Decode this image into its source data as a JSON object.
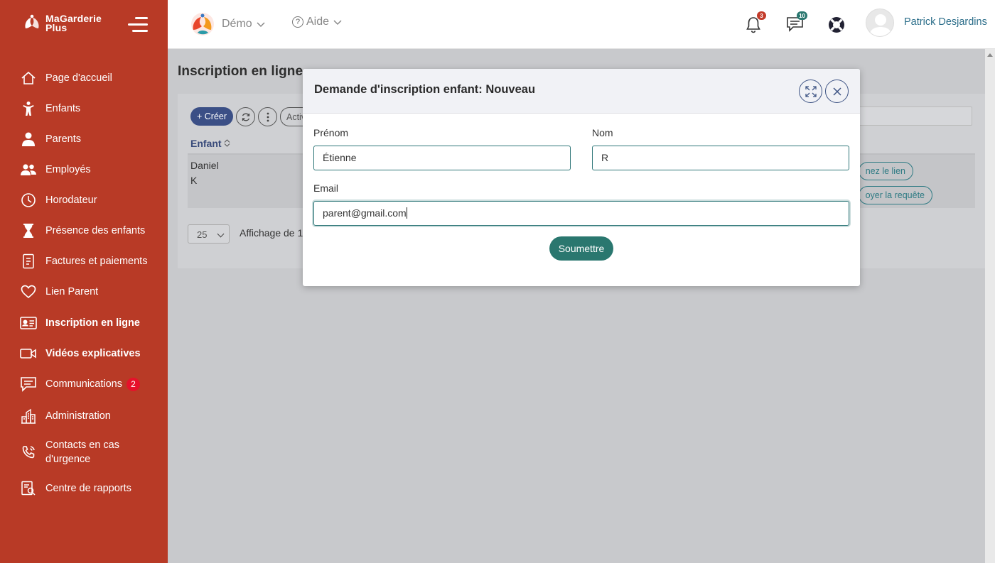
{
  "brand": {
    "line1": "MaGarderie",
    "line2": "Plus"
  },
  "sidebar": {
    "items": [
      {
        "label": "Page d'accueil",
        "icon": "home-icon"
      },
      {
        "label": "Enfants",
        "icon": "child-icon"
      },
      {
        "label": "Parents",
        "icon": "parent-icon"
      },
      {
        "label": "Employés",
        "icon": "employees-icon"
      },
      {
        "label": "Horodateur",
        "icon": "clock-icon"
      },
      {
        "label": "Présence des enfants",
        "icon": "hourglass-icon"
      },
      {
        "label": "Factures et paiements",
        "icon": "invoice-icon"
      },
      {
        "label": "Lien Parent",
        "icon": "heart-icon"
      },
      {
        "label": "Inscription en ligne",
        "icon": "id-card-icon",
        "active": true
      },
      {
        "label": "Vidéos explicatives",
        "icon": "video-icon"
      },
      {
        "label": "Communications",
        "icon": "chat-icon",
        "badge": "2"
      },
      {
        "label": "Administration",
        "icon": "building-icon"
      },
      {
        "label": "Contacts en cas",
        "label2": "d'urgence",
        "icon": "phone-icon"
      },
      {
        "label": "Centre de rapports",
        "icon": "report-icon"
      }
    ]
  },
  "header": {
    "demo_label": "Démo",
    "help_label": "Aide",
    "notifications_count": "3",
    "messages_count": "10",
    "user_name": "Patrick Desjardins"
  },
  "main": {
    "title": "Inscription en ligne",
    "toolbar": {
      "create_label": "+ Créer",
      "activ_label": "Activ"
    },
    "table": {
      "column_enfant": "Enfant",
      "row": {
        "first_name": "Daniel",
        "last_name": "K",
        "action1": "nez le lien",
        "action2": "oyer la requête"
      }
    },
    "pager": {
      "page_size": "25",
      "info": "Affichage de 1"
    }
  },
  "modal": {
    "title": "Demande d'inscription enfant: Nouveau",
    "prenom_label": "Prénom",
    "prenom_value": "Étienne",
    "nom_label": "Nom",
    "nom_value": "R",
    "email_label": "Email",
    "email_value": "parent@gmail.com",
    "submit_label": "Soumettre"
  },
  "colors": {
    "sidebar_bg": "#b83a26",
    "primary_teal": "#2a776f",
    "create_button": "#3b4f86",
    "badge_red": "#e6112a"
  }
}
